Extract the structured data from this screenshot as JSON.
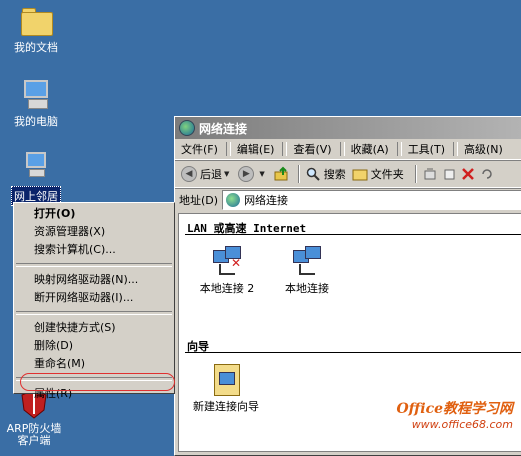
{
  "desktop": {
    "icons": [
      {
        "label": "我的文档"
      },
      {
        "label": "我的电脑"
      },
      {
        "label": "网上邻居"
      },
      {
        "label": "ARP防火墙客户端"
      }
    ]
  },
  "window": {
    "title": "网络连接",
    "menu": [
      "文件(F)",
      "编辑(E)",
      "查看(V)",
      "收藏(A)",
      "工具(T)",
      "高级(N)"
    ],
    "toolbar": {
      "back": "后退",
      "search": "搜索",
      "folders": "文件夹"
    },
    "address": {
      "label": "地址(D)",
      "value": "网络连接"
    },
    "sections": [
      {
        "title": "LAN 或高速 Internet",
        "items": [
          "本地连接 2",
          "本地连接"
        ]
      },
      {
        "title": "向导",
        "items": [
          "新建连接向导"
        ]
      }
    ]
  },
  "context_menu": {
    "items": [
      {
        "label": "打开(O)",
        "bold": true
      },
      {
        "label": "资源管理器(X)"
      },
      {
        "label": "搜索计算机(C)..."
      },
      {
        "sep": true
      },
      {
        "label": "映射网络驱动器(N)..."
      },
      {
        "label": "断开网络驱动器(I)..."
      },
      {
        "sep": true
      },
      {
        "label": "创建快捷方式(S)"
      },
      {
        "label": "删除(D)"
      },
      {
        "label": "重命名(M)"
      },
      {
        "sep": true
      },
      {
        "label": "属性(R)",
        "highlighted": true
      }
    ]
  },
  "watermark": {
    "line1": "Office教程学习网",
    "line2": "www.office68.com"
  },
  "colors": {
    "desktop": "#3a6ea5",
    "highlight_ring": "#e03030",
    "watermark": "#e06010"
  }
}
